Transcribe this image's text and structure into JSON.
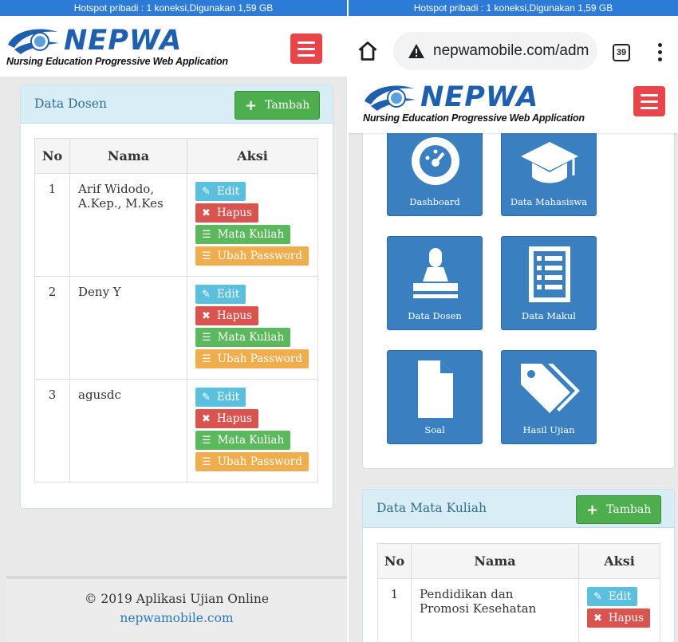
{
  "status_bar": "Hotspot pribadi : 1 koneksi,Digunakan 1,59 GB",
  "logo": {
    "name": "NEPWA",
    "subtitle": "Nursing Education Progressive Web Application"
  },
  "left": {
    "box_title": "Data Dosen",
    "add_button": "Tambah",
    "table": {
      "headers": [
        "No",
        "Nama",
        "Aksi"
      ],
      "rows": [
        {
          "no": "1",
          "nama_line1": "Arif Widodo,",
          "nama_line2": "A.Kep., M.Kes"
        },
        {
          "no": "2",
          "nama_line1": "Deny Y",
          "nama_line2": ""
        },
        {
          "no": "3",
          "nama_line1": "agusdc",
          "nama_line2": ""
        }
      ],
      "actions": {
        "edit": "Edit",
        "hapus": "Hapus",
        "matkul": "Mata Kuliah",
        "password": "Ubah Password"
      }
    },
    "footer": {
      "copyright": "© 2019 Aplikasi Ujian Online",
      "link": "nepwamobile.com"
    }
  },
  "right": {
    "browser": {
      "url": "nepwamobile.com/adm",
      "tab_count": "39"
    },
    "tiles": [
      {
        "label": "Dashboard",
        "icon": "dashboard-icon"
      },
      {
        "label": "Data Mahasiswa",
        "icon": "graduation-cap-icon"
      },
      {
        "label": "Data Dosen",
        "icon": "stamp-icon"
      },
      {
        "label": "Data Makul",
        "icon": "list-alt-icon"
      },
      {
        "label": "Soal",
        "icon": "file-icon"
      },
      {
        "label": "Hasil Ujian",
        "icon": "tags-icon"
      }
    ],
    "box_title": "Data Mata Kuliah",
    "add_button": "Tambah",
    "table": {
      "headers": [
        "No",
        "Nama",
        "Aksi"
      ],
      "rows": [
        {
          "no": "1",
          "nama_line1": "Pendidikan dan",
          "nama_line2": "Promosi Kesehatan"
        }
      ],
      "actions": {
        "edit": "Edit",
        "hapus": "Hapus"
      }
    }
  },
  "colors": {
    "brand": "#1e5fae",
    "header_bg": "#d9edf7",
    "success": "#5cb85c",
    "danger": "#d9534f",
    "info": "#5bc0de",
    "warning": "#f0ad4e",
    "menu": "#e8454a",
    "tile": "#3a80c1"
  }
}
